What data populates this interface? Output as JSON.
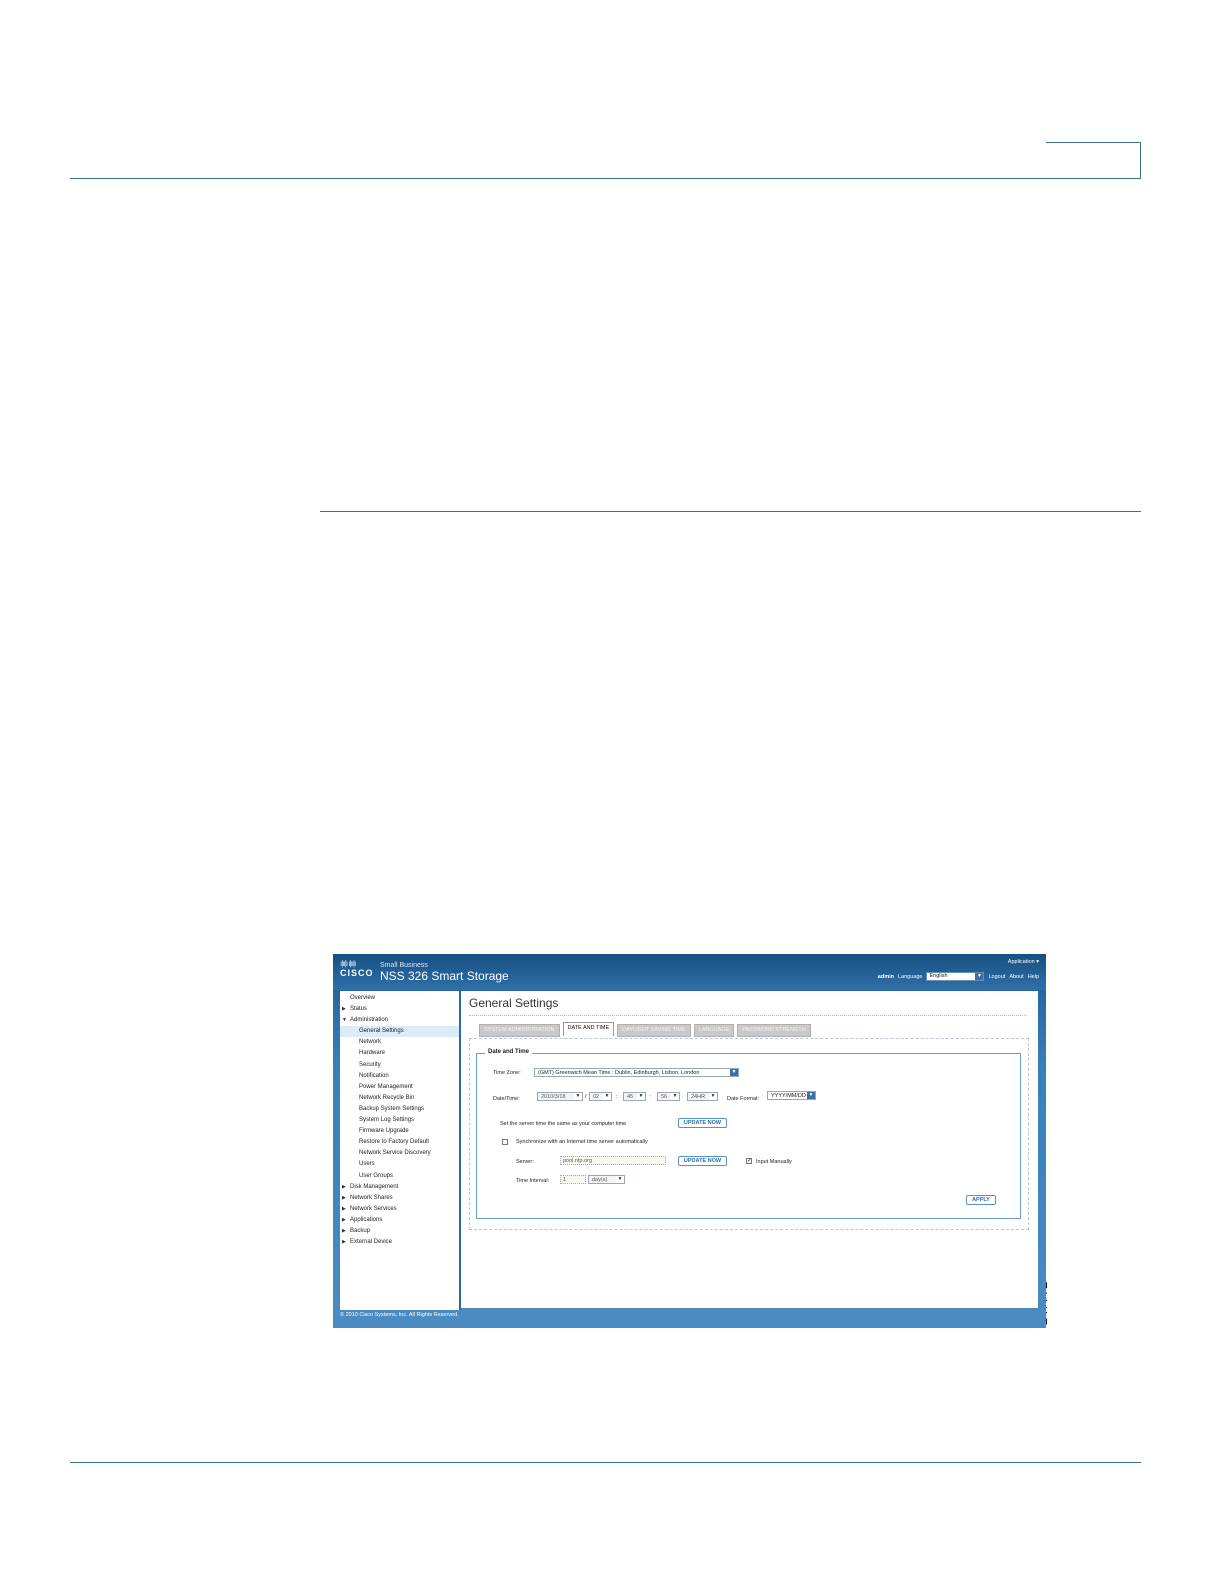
{
  "figure": {
    "id": "247772"
  },
  "app": {
    "brand_small": "Small Business",
    "brand_word": "CISCO",
    "title": "NSS 326 Smart Storage",
    "application_menu": "Application ▾",
    "user": "admin",
    "language_label": "Language",
    "language_value": "English",
    "logout": "Logout",
    "about": "About",
    "help": "Help"
  },
  "sidebar": {
    "items": [
      {
        "label": "Overview",
        "level": 0,
        "arrow": ""
      },
      {
        "label": "Status",
        "level": 0,
        "arrow": "▶"
      },
      {
        "label": "Administration",
        "level": 0,
        "arrow": "▼"
      },
      {
        "label": "General Settings",
        "level": 1,
        "arrow": "",
        "active": true
      },
      {
        "label": "Network",
        "level": 1,
        "arrow": ""
      },
      {
        "label": "Hardware",
        "level": 1,
        "arrow": ""
      },
      {
        "label": "Security",
        "level": 1,
        "arrow": ""
      },
      {
        "label": "Notification",
        "level": 1,
        "arrow": ""
      },
      {
        "label": "Power Management",
        "level": 1,
        "arrow": ""
      },
      {
        "label": "Network Recycle Bin",
        "level": 1,
        "arrow": ""
      },
      {
        "label": "Backup System Settings",
        "level": 1,
        "arrow": ""
      },
      {
        "label": "System Log Settings",
        "level": 1,
        "arrow": ""
      },
      {
        "label": "Firmware Upgrade",
        "level": 1,
        "arrow": ""
      },
      {
        "label": "Restore to Factory Default",
        "level": 1,
        "arrow": ""
      },
      {
        "label": "Network Service Discovery",
        "level": 1,
        "arrow": ""
      },
      {
        "label": "Users",
        "level": 1,
        "arrow": ""
      },
      {
        "label": "User Groups",
        "level": 1,
        "arrow": ""
      },
      {
        "label": "Disk Management",
        "level": 0,
        "arrow": "▶"
      },
      {
        "label": "Network Shares",
        "level": 0,
        "arrow": "▶"
      },
      {
        "label": "Network Services",
        "level": 0,
        "arrow": "▶"
      },
      {
        "label": "Applications",
        "level": 0,
        "arrow": "▶"
      },
      {
        "label": "Backup",
        "level": 0,
        "arrow": "▶"
      },
      {
        "label": "External Device",
        "level": 0,
        "arrow": "▶"
      }
    ]
  },
  "main": {
    "page_title": "General Settings",
    "tabs": [
      {
        "label": "SYSTEM ADMINISTRATION",
        "active": false
      },
      {
        "label": "DATE AND TIME",
        "active": true
      },
      {
        "label": "DAYLIGHT SAVING TIME",
        "active": false
      },
      {
        "label": "LANGUAGE",
        "active": false
      },
      {
        "label": "PASSWORD STRENGTH",
        "active": false
      }
    ],
    "section_title": "Date and Time",
    "time_zone_label": "Time Zone:",
    "time_zone_value": "(GMT) Greenwich Mean Time : Dublin, Edinburgh, Lisbon, London",
    "datetime_label": "Date/Time:",
    "date_value": "2010/3/18",
    "sep_slash": "/",
    "sep_colon": ":",
    "hour_value": "02",
    "minute_value": "45",
    "second_value": "56",
    "clock_format": "24HR",
    "date_format_label": "Date Format:",
    "date_format_value": "YYYY/MM/DD",
    "set_server_time_text": "Set the server time the same as your computer time",
    "update_now_label": "UPDATE NOW",
    "sync_label": "Synchronize with an Internet time server automatically",
    "sync_checked": false,
    "server_label": "Server:",
    "server_value": "pool.ntp.org",
    "input_manually_label": "Input Manually",
    "input_manually_checked": true,
    "check_mark": "✓",
    "time_interval_label": "Time Interval:",
    "time_interval_value": "1",
    "time_interval_unit": "day(s)",
    "apply_label": "APPLY"
  },
  "footer": {
    "copyright": "© 2010 Cisco Systems, Inc. All Rights Reserved."
  }
}
